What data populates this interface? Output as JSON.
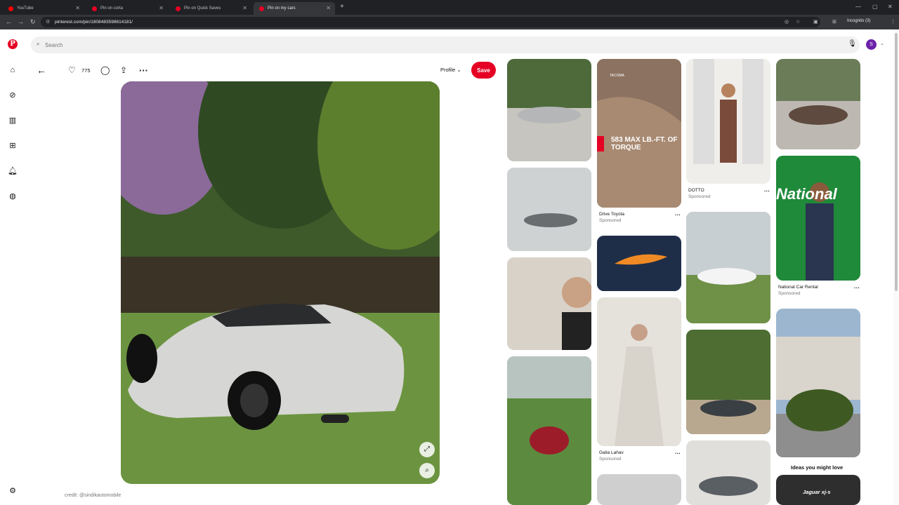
{
  "browser": {
    "tabs": [
      {
        "label": "YouTube",
        "color": "#ff0000"
      },
      {
        "label": "Pin on corta",
        "color": "#e60023"
      },
      {
        "label": "Pin on Quick Saves",
        "color": "#e60023"
      },
      {
        "label": "Pin on my cars",
        "color": "#e60023"
      }
    ],
    "url": "pinterest.com/pin/1808483598614181/",
    "incognito": "Incognito (3)"
  },
  "header": {
    "search_placeholder": "Search",
    "avatar_initial": "S"
  },
  "pin": {
    "likes": "775",
    "profile_label": "Profile",
    "save_label": "Save",
    "credit": "credit: @sindikautomobile"
  },
  "feed": {
    "ad_headline": "583 MAX LB.-FT. OF TORQUE",
    "ad_brand": "TACOMA",
    "drive_toyota": {
      "title": "Drive Toyota",
      "sub": "Sponsored"
    },
    "dotto": {
      "title": "DOTTO",
      "sub": "Sponsored"
    },
    "national": {
      "title": "National Car Rental",
      "sub": "Sponsored",
      "sign": "National"
    },
    "galia": {
      "title": "Galia Lahav",
      "sub": "Sponsored"
    },
    "ideas_label": "Ideas you might love",
    "jaguar": "Jaguar xj-s"
  },
  "colors": {
    "pinterest_red": "#e60023",
    "avatar_purple": "#6b21a8"
  }
}
